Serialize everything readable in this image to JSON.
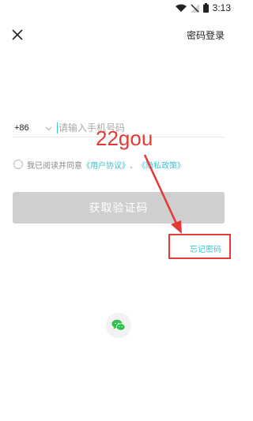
{
  "status_bar": {
    "time": "3:13"
  },
  "header": {
    "password_login_label": "密码登录"
  },
  "phone": {
    "country_code": "+86",
    "placeholder": "请输入手机号码"
  },
  "agreement": {
    "prefix": "我已阅读并同意",
    "user_agreement": "《用户协议》",
    "separator": "、",
    "privacy_policy": "《隐私政策》"
  },
  "primary_button_label": "获取验证码",
  "forgot_password_label": "忘记密码",
  "watermark_text": "22gou",
  "colors": {
    "accent": "#3ec2d0",
    "annotation": "#e53935",
    "button_disabled": "#cfcfcf"
  },
  "icons": [
    "wifi-icon",
    "signal-icon",
    "battery-icon",
    "close-icon",
    "chevron-down-icon",
    "wechat-icon"
  ]
}
